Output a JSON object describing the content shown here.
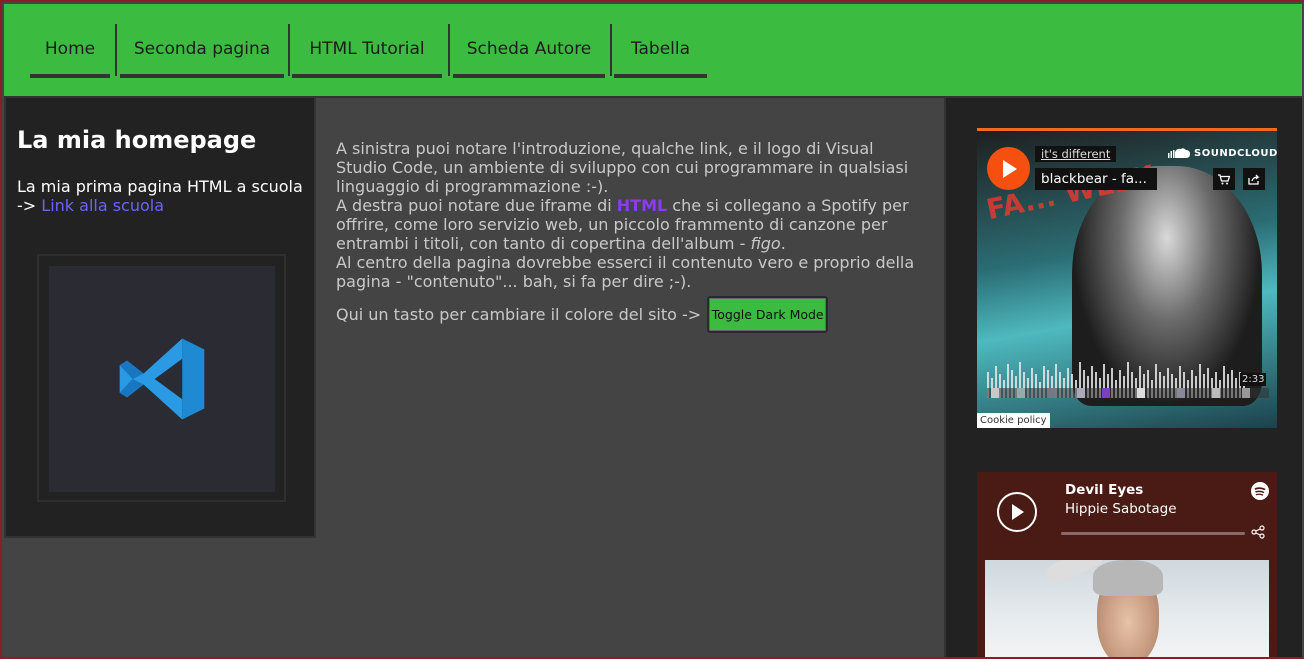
{
  "nav": {
    "items": [
      {
        "label": "Home"
      },
      {
        "label": "Seconda pagina"
      },
      {
        "label": "HTML Tutorial"
      },
      {
        "label": "Scheda Autore"
      },
      {
        "label": "Tabella"
      }
    ]
  },
  "left": {
    "title": "La mia homepage",
    "intro_text": "La mia prima pagina HTML a scuola",
    "arrow": "->",
    "link_label": "Link alla scuola"
  },
  "center": {
    "p1": "A sinistra puoi notare l'introduzione, qualche link, e il logo di Visual Studio Code, un ambiente di sviluppo con cui programmare in qualsiasi linguaggio di programmazione :-).",
    "p2_a": "A destra puoi notare due iframe di ",
    "p2_html": "HTML",
    "p2_b": " che si collegano a Spotify per offrire, come loro servizio web, un piccolo frammento di canzone per entrambi i titoli, con tanto di copertina dell'album - ",
    "p2_figo": "figo",
    "p2_c": ".",
    "p3": "Al centro della pagina dovrebbe esserci il contenuto vero e proprio della pagina - \"contenuto\"... bah, si fa per dire ;-).",
    "toggle_text": "Qui un tasto per cambiare il colore del sito ->",
    "toggle_button": "Toggle Dark Mode"
  },
  "soundcloud": {
    "user": "it's different",
    "track": "blackbear - fa...",
    "brand": "SOUNDCLOUD",
    "duration": "2:33",
    "cookie": "Cookie policy",
    "art_text": "FA... WEEK"
  },
  "spotify": {
    "title": "Devil Eyes",
    "artist": "Hippie Sabotage"
  }
}
